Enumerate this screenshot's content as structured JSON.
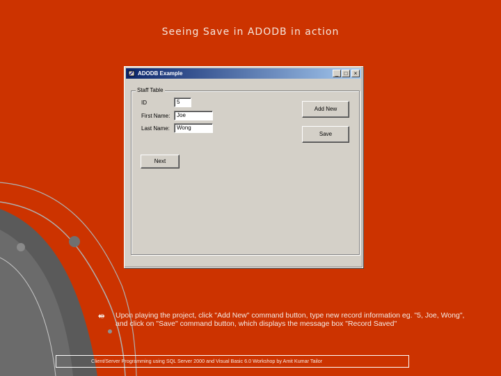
{
  "slide": {
    "title": "Seeing Save in ADODB in action",
    "body": "Upon playing the project, click \"Add New\" command button, type new record information eg. \"5, Joe, Wong\", and click on \"Save\" command button, which displays the message box \"Record Saved\"",
    "footer": "Client/Server Programming using SQL Server 2000 and Visual Basic 6.0 Workshop by Amit Kumar Tailor"
  },
  "window": {
    "title": "ADODB Example",
    "minimize_glyph": "_",
    "maximize_glyph": "□",
    "close_glyph": "×"
  },
  "form": {
    "group_label": "Staff Table",
    "id_label": "ID",
    "id_value": "5",
    "first_name_label": "First Name:",
    "first_name_value": "Joe",
    "last_name_label": "Last Name:",
    "last_name_value": "Wong",
    "add_new_label": "Add New",
    "save_label": "Save",
    "next_label": "Next"
  },
  "colors": {
    "background": "#cc3300",
    "title_bar": "#0a246a",
    "window_face": "#d4d0c8"
  },
  "icons": [
    "window-app-icon",
    "bullet-icon"
  ]
}
